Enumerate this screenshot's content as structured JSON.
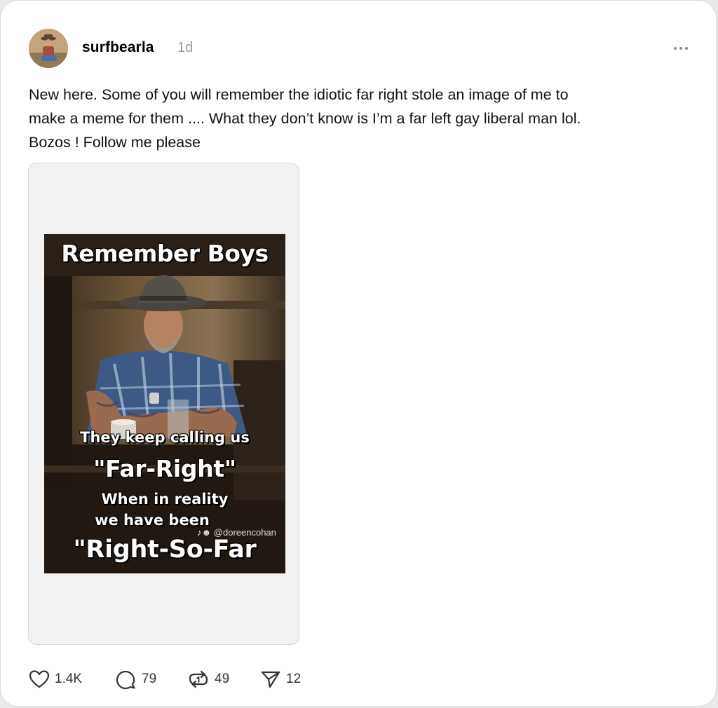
{
  "post": {
    "username": "surfbearla",
    "timestamp": "1d",
    "more_label": "•••",
    "text": "New here. Some of you will remember the idiotic far right stole an image of me to\nmake a meme for them .... What they don’t know is I’m a far left gay liberal man lol.\nBozos ! Follow me please"
  },
  "meme": {
    "title": "Remember Boys",
    "line1": "They keep calling us",
    "line2": "\"Far-Right\"",
    "line3": "When in reality",
    "line4": "we have been",
    "line5": "\"Right-So-Far",
    "watermark": "♪☻ @doreencohan"
  },
  "actions": {
    "likes": "1.4K",
    "replies": "79",
    "reposts": "49",
    "shares": "12"
  },
  "icons": [
    "heart-icon",
    "comment-icon",
    "repost-icon",
    "send-icon",
    "more-icon"
  ],
  "colors": {
    "card_bg": "#ffffff",
    "muted_text": "#9a9a9a",
    "media_frame_bg": "#f2f2f2"
  }
}
